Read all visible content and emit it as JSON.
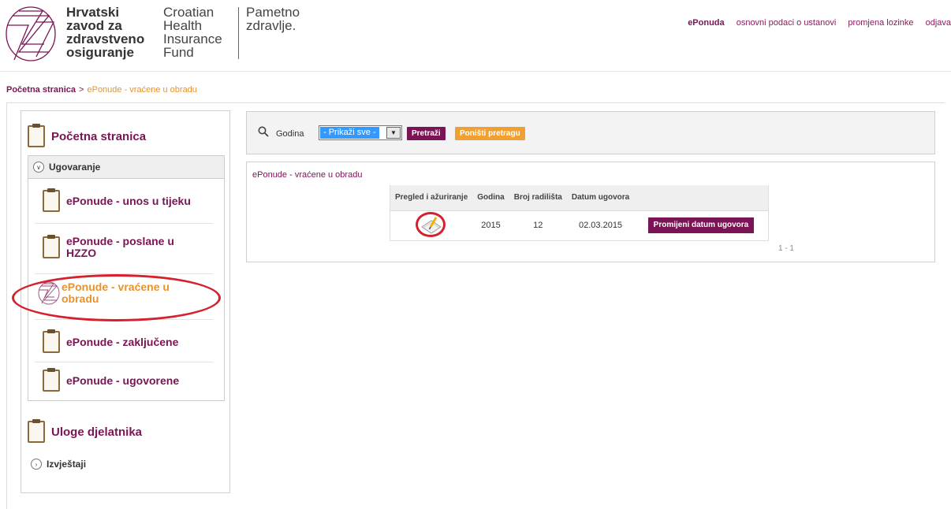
{
  "header": {
    "org_name_hr": [
      "Hrvatski",
      "zavod za",
      "zdravstveno",
      "osiguranje"
    ],
    "org_name_en": [
      "Croatian",
      "Health",
      "Insurance",
      "Fund"
    ],
    "slogan": [
      "Pametno",
      "zdravlje."
    ],
    "nav": [
      "ePonuda",
      "osnovni podaci o ustanovi",
      "promjena lozinke",
      "odjava"
    ]
  },
  "breadcrumb": {
    "home": "Početna stranica",
    "separator": ">",
    "current": "ePonude - vraćene u obradu"
  },
  "sidebar": {
    "home": "Početna stranica",
    "section": "Ugovaranje",
    "items": [
      "ePonude - unos u tijeku",
      "ePonude - poslane u HZZO",
      "ePonude - vraćene u obradu",
      "ePonude - zaključene",
      "ePonude - ugovorene"
    ],
    "active_index": 2,
    "roles": "Uloge djelatnika",
    "reports": "Izvještaji"
  },
  "search": {
    "label": "Godina",
    "selected": "- Prikaži sve -",
    "search_button": "Pretraži",
    "reset_button": "Poništi pretragu"
  },
  "results": {
    "title": "ePonude - vraćene u obradu",
    "columns": [
      "Pregled i ažuriranje",
      "Godina",
      "Broj radilišta",
      "Datum ugovora",
      ""
    ],
    "rows": [
      {
        "godina": "2015",
        "broj_radilista": "12",
        "datum_ugovora": "02.03.2015",
        "action": "Promijeni datum ugovora"
      }
    ],
    "pager": "1 - 1"
  },
  "colors": {
    "brand": "#7a1454",
    "accent": "#e8932a",
    "highlight": "#d5212e"
  }
}
